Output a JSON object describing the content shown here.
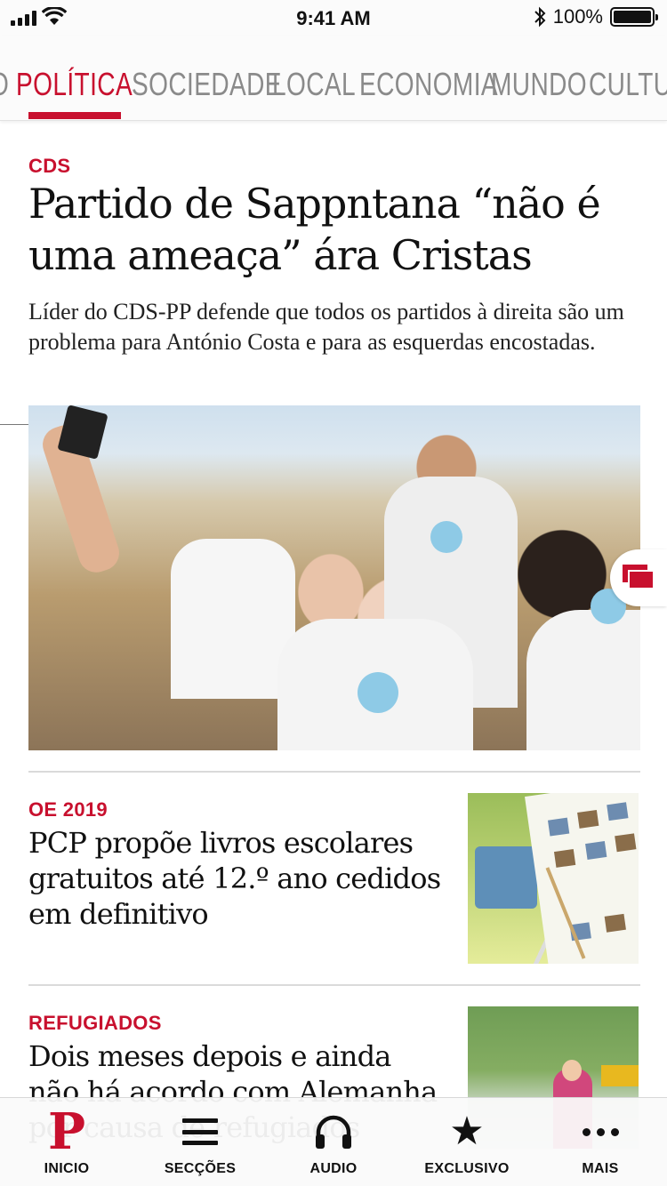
{
  "status_bar": {
    "time": "9:41 AM",
    "battery_text": "100%",
    "battery_level": 1.0,
    "icons": [
      "cellular-signal-icon",
      "wifi-icon",
      "bluetooth-icon",
      "battery-icon"
    ]
  },
  "sections": {
    "items": [
      {
        "label": "O",
        "active": false
      },
      {
        "label": "POLÍTICA",
        "active": true
      },
      {
        "label": "SOCIEDADE",
        "active": false
      },
      {
        "label": "LOCAL",
        "active": false
      },
      {
        "label": "ECONOMIA",
        "active": false
      },
      {
        "label": "MUNDO",
        "active": false
      },
      {
        "label": "CULTU",
        "active": false
      }
    ]
  },
  "lead": {
    "kicker": "CDS",
    "title": "Partido de Sappntana “não é uma ameaça” ára Cristas",
    "summary": "Líder do CDS-PP defende que todos os partidos à direita são um problema para António Costa e para as esquerdas encostadas.",
    "photo_icon": "photo-gallery-icon"
  },
  "articles": [
    {
      "kicker": "OE 2019",
      "title": "PCP propõe livros escolares gratuitos até 12.º ano cedidos em definitivo"
    },
    {
      "kicker": "REFUGIADOS",
      "title": "Dois meses depois e ainda não há acordo com Alemanha por causa de refugiados"
    }
  ],
  "tab_bar": {
    "items": [
      {
        "label": "INICIO",
        "icon": "publico-logo-icon"
      },
      {
        "label": "SECÇÕES",
        "icon": "menu-icon"
      },
      {
        "label": "AUDIO",
        "icon": "headphones-icon"
      },
      {
        "label": "EXCLUSIVO",
        "icon": "star-icon"
      },
      {
        "label": "MAIS",
        "icon": "more-icon"
      }
    ]
  },
  "colors": {
    "accent": "#c8102e",
    "tab_inactive": "#8a8a8a",
    "text": "#111111"
  }
}
